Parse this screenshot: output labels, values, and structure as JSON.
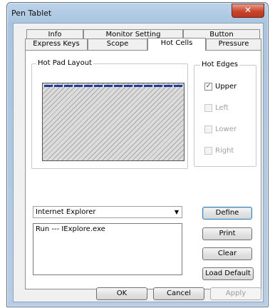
{
  "window": {
    "title": "Pen Tablet",
    "close_glyph": "✕"
  },
  "tabs": {
    "row_back": [
      "Info",
      "Monitor Setting",
      "Button"
    ],
    "row_front": [
      "Express Keys",
      "Scope",
      "Hot Cells",
      "Pressure"
    ],
    "active": "Hot Cells"
  },
  "hot_pad": {
    "legend": "Hot Pad Layout",
    "active_cell_count": 14,
    "active_cell_color": "#1f3c9a"
  },
  "hot_edges": {
    "legend": "Hot Edges",
    "items": [
      {
        "label": "Upper",
        "checked": true,
        "enabled": true
      },
      {
        "label": "Left",
        "checked": false,
        "enabled": false
      },
      {
        "label": "Lower",
        "checked": false,
        "enabled": false
      },
      {
        "label": "Right",
        "checked": false,
        "enabled": false
      }
    ]
  },
  "app_select": {
    "value": "Internet Explorer"
  },
  "command_list": {
    "items": [
      "Run --- IExplore.exe"
    ]
  },
  "side_buttons": {
    "define": "Define",
    "print": "Print",
    "clear": "Clear",
    "load_default": "Load Default"
  },
  "footer": {
    "ok": "OK",
    "cancel": "Cancel",
    "apply": "Apply"
  }
}
